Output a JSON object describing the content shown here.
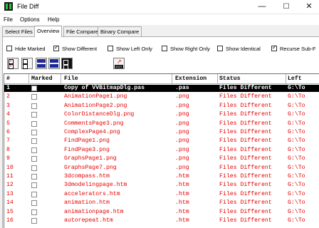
{
  "window": {
    "title": "File Diff",
    "min": "—",
    "max": "☐",
    "close": "✕"
  },
  "menu": [
    "File",
    "Options",
    "Help"
  ],
  "tabs": [
    "Select Files",
    "Overview",
    "File Compare",
    "Binary Compare"
  ],
  "options": [
    {
      "label": "Hide Marked",
      "checked": false
    },
    {
      "label": "Show Different",
      "checked": true
    },
    {
      "label": "Show Left Only",
      "checked": false
    },
    {
      "label": "Show Right Only",
      "checked": false
    },
    {
      "label": "Show Identical",
      "checked": false
    },
    {
      "label": "Recurse Sub-F",
      "checked": true
    }
  ],
  "toolbar": {
    "exit_label": "EXIT"
  },
  "grid": {
    "headers": [
      "#",
      "Marked",
      "File",
      "Extension",
      "Status",
      "Left"
    ],
    "rows": [
      [
        "1",
        "Copy of VVBitmapDlg.pas",
        ".pas",
        "Files Different",
        "G:\\To"
      ],
      [
        "2",
        "AnimationPage1.png",
        ".png",
        "Files Different",
        "G:\\To"
      ],
      [
        "3",
        "AnimationPage2.png",
        ".png",
        "Files Different",
        "G:\\To"
      ],
      [
        "4",
        "ColorDistanceDlg.png",
        ".png",
        "Files Different",
        "G:\\To"
      ],
      [
        "5",
        "CommentsPage3.png",
        ".png",
        "Files Different",
        "G:\\To"
      ],
      [
        "6",
        "ComplexPage4.png",
        ".png",
        "Files Different",
        "G:\\To"
      ],
      [
        "7",
        "FindPage1.png",
        ".png",
        "Files Different",
        "G:\\To"
      ],
      [
        "8",
        "FindPage3.png",
        ".png",
        "Files Different",
        "G:\\To"
      ],
      [
        "9",
        "GraphsPage1.png",
        ".png",
        "Files Different",
        "G:\\To"
      ],
      [
        "10",
        "GraphsPage7.png",
        ".png",
        "Files Different",
        "G:\\To"
      ],
      [
        "11",
        "3dcompass.htm",
        ".htm",
        "Files Different",
        "G:\\To"
      ],
      [
        "12",
        "3dmodelingpage.htm",
        ".htm",
        "Files Different",
        "G:\\To"
      ],
      [
        "13",
        "accelerators.htm",
        ".htm",
        "Files Different",
        "G:\\To"
      ],
      [
        "14",
        "animation.htm",
        ".htm",
        "Files Different",
        "G:\\To"
      ],
      [
        "15",
        "animationpage.htm",
        ".htm",
        "Files Different",
        "G:\\To"
      ],
      [
        "16",
        "autorepeat.htm",
        ".htm",
        "Files Different",
        "G:\\To"
      ]
    ]
  }
}
